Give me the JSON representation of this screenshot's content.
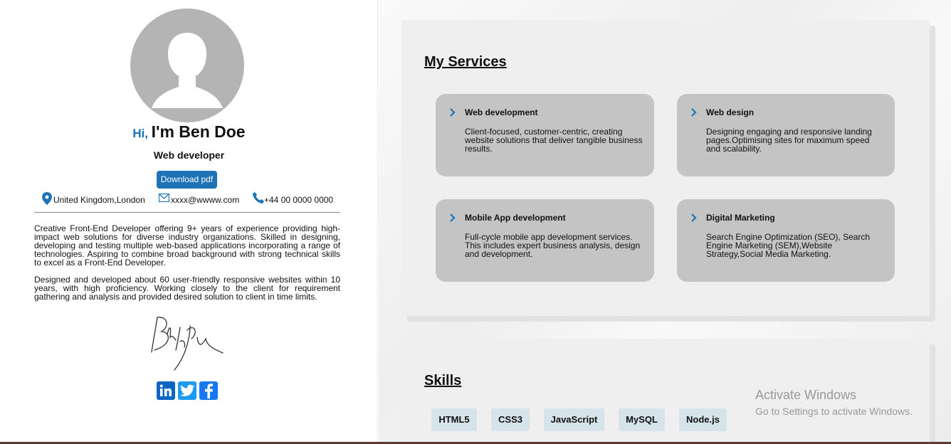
{
  "profile": {
    "greeting": "Hi,",
    "name": "I'm Ben Doe",
    "role": "Web developer",
    "download_label": "Download pdf",
    "location": "United Kingdom,London",
    "email": "xxxx@wwww.com",
    "phone": "+44 00 0000 0000",
    "bio_1": "Creative Front-End Developer offering 9+ years of experience providing high-impact web solutions for diverse industry organizations. Skilled in designing, developing and testing multiple web-based applications incorporating a range of technologies. Aspiring to combine broad background with strong technical skills to excel as a Front-End Developer.",
    "bio_2": "Designed and developed about 60 user-friendly responsive websites within 10 years, with high proficiency. Working closely to the client for requirement gathering and analysis and provided desired solution to client in time limits."
  },
  "services": {
    "title": "My Services",
    "items": [
      {
        "title": "Web development",
        "desc": "Client-focused, customer-centric, creating website solutions that deliver tangible business results."
      },
      {
        "title": "Web design",
        "desc": "Designing engaging and responsive landing pages.Optimising sites for maximum speed and scalability."
      },
      {
        "title": "Mobile App development",
        "desc": "Full-cycle mobile app development services. This includes expert business analysis, design and development."
      },
      {
        "title": "Digital Marketing",
        "desc": "Search Engine Optimization (SEO), Search Engine Marketing (SEM),Website Strategy,Social Media Marketing."
      }
    ]
  },
  "skills": {
    "title": "Skills",
    "items": [
      "HTML5",
      "CSS3",
      "JavaScript",
      "MySQL",
      "Node.js"
    ]
  },
  "watermark": {
    "line1": "Activate Windows",
    "line2": "Go to Settings to activate Windows."
  },
  "colors": {
    "accent": "#1d73b6",
    "card": "#c4c4c4",
    "skill_chip": "#d6e3ea"
  },
  "icons": [
    "avatar-silhouette",
    "location-pin-icon",
    "envelope-icon",
    "phone-icon",
    "chevron-right-icon",
    "linkedin-icon",
    "twitter-icon",
    "facebook-icon"
  ]
}
